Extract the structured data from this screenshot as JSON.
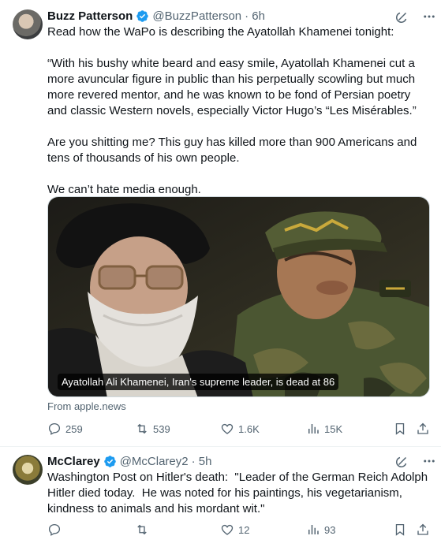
{
  "tweets": [
    {
      "display_name": "Buzz Patterson",
      "handle": "@BuzzPatterson",
      "time": "· 6h",
      "text": "Read how the WaPo is describing the Ayatollah Khamenei tonight:\n\n“With his bushy white beard and easy smile, Ayatollah Khamenei cut a more avuncular figure in public than his perpetually scowling but much more revered mentor, and he was known to be fond of Persian poetry and classic Western novels, especially Victor Hugo’s “Les Misérables.”\n\nAre you shitting me? This guy has killed more than 900 Americans and tens of thousands of his own people.\n\nWe can’t hate media enough.",
      "media_caption": "Ayatollah Ali Khamenei, Iran's supreme leader, is dead at 86",
      "source": "From apple.news",
      "replies": "259",
      "reposts": "539",
      "likes": "1.6K",
      "views": "15K"
    },
    {
      "display_name": "McClarey",
      "handle": "@McClarey2",
      "time": "· 5h",
      "text": "Washington Post on Hitler's death:  \"Leader of the German Reich Adolph Hitler died today.  He was noted for his paintings, his vegetarianism, kindness to animals and his mordant wit.\"",
      "replies": "",
      "reposts": "",
      "likes": "12",
      "views": "93"
    }
  ],
  "icons": [
    "verified-badge-icon",
    "grok-icon",
    "more-icon",
    "reply-icon",
    "repost-icon",
    "like-icon",
    "views-icon",
    "bookmark-icon",
    "share-icon"
  ],
  "colors": {
    "verified": "#1d9bf0",
    "muted": "#536471",
    "text": "#0f1419"
  }
}
